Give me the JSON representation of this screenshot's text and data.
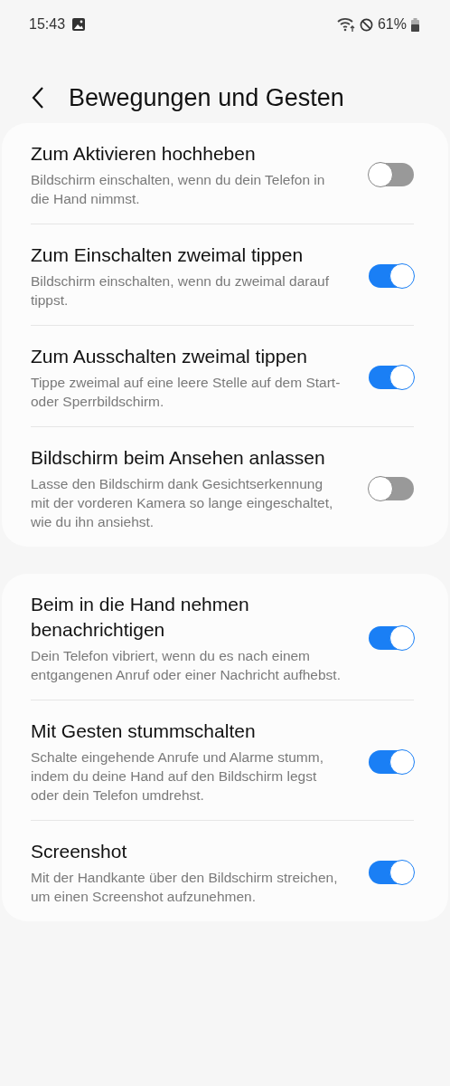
{
  "status_bar": {
    "time": "15:43",
    "battery": "61%"
  },
  "header": {
    "title": "Bewegungen und Gesten"
  },
  "groups": [
    {
      "items": [
        {
          "title": "Zum Aktivieren hochheben",
          "subtitle": "Bildschirm einschalten, wenn du dein Telefon in die Hand nimmst.",
          "on": false
        },
        {
          "title": "Zum Einschalten zweimal tippen",
          "subtitle": "Bildschirm einschalten, wenn du zweimal darauf tippst.",
          "on": true
        },
        {
          "title": "Zum Ausschalten zweimal tippen",
          "subtitle": "Tippe zweimal auf eine leere Stelle auf dem Start- oder Sperrbildschirm.",
          "on": true
        },
        {
          "title": "Bildschirm beim Ansehen anlassen",
          "subtitle": "Lasse den Bildschirm dank Gesichtserkennung mit der vorderen Kamera so lange eingeschaltet, wie du ihn ansiehst.",
          "on": false
        }
      ]
    },
    {
      "items": [
        {
          "title": "Beim in die Hand nehmen benachrichtigen",
          "subtitle": "Dein Telefon vibriert, wenn du es nach einem entgangenen Anruf oder einer Nachricht aufhebst.",
          "on": true
        },
        {
          "title": "Mit Gesten stummschalten",
          "subtitle": "Schalte eingehende Anrufe und Alarme stumm, indem du deine Hand auf den Bildschirm legst oder dein Telefon umdrehst.",
          "on": true
        },
        {
          "title": "Screenshot",
          "subtitle": "Mit der Handkante über den Bildschirm streichen, um einen Screenshot aufzunehmen.",
          "on": true
        }
      ]
    }
  ]
}
